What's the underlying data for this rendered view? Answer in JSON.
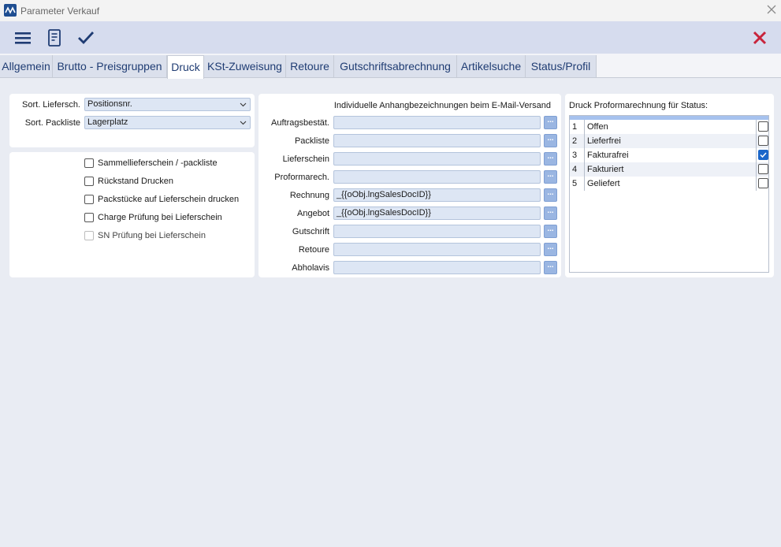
{
  "window": {
    "title": "Parameter Verkauf"
  },
  "tabs": [
    {
      "label": "Allgemein"
    },
    {
      "label": "Brutto - Preisgruppen"
    },
    {
      "label": "Druck"
    },
    {
      "label": "KSt-Zuweisung"
    },
    {
      "label": "Retoure"
    },
    {
      "label": "Gutschriftsabrechnung"
    },
    {
      "label": "Artikelsuche"
    },
    {
      "label": "Status/Profil"
    }
  ],
  "sort": {
    "liefersch_label": "Sort. Liefersch.",
    "liefersch_value": "Positionsnr.",
    "packliste_label": "Sort. Packliste",
    "packliste_value": "Lagerplatz"
  },
  "checkboxes": [
    {
      "label": "Sammellieferschein / -packliste",
      "checked": false,
      "disabled": false
    },
    {
      "label": "Rückstand Drucken",
      "checked": false,
      "disabled": false
    },
    {
      "label": "Packstücke auf Lieferschein drucken",
      "checked": false,
      "disabled": false
    },
    {
      "label": "Charge Prüfung bei Lieferschein",
      "checked": false,
      "disabled": false
    },
    {
      "label": "SN Prüfung bei Lieferschein",
      "checked": false,
      "disabled": true
    }
  ],
  "email": {
    "heading": "Individuelle Anhangbezeichnungen beim E-Mail-Versand",
    "button_label": "...",
    "fields": [
      {
        "label": "Auftragsbestät.",
        "value": ""
      },
      {
        "label": "Packliste",
        "value": ""
      },
      {
        "label": "Lieferschein",
        "value": ""
      },
      {
        "label": "Proformarech.",
        "value": ""
      },
      {
        "label": "Rechnung",
        "value": "_{{oObj.lngSalesDocID}}"
      },
      {
        "label": "Angebot",
        "value": "_{{oObj.lngSalesDocID}}"
      },
      {
        "label": "Gutschrift",
        "value": ""
      },
      {
        "label": "Retoure",
        "value": ""
      },
      {
        "label": "Abholavis",
        "value": ""
      }
    ]
  },
  "status": {
    "heading": "Druck Proformarechnung für Status:",
    "rows": [
      {
        "num": "1",
        "name": "Offen",
        "checked": false
      },
      {
        "num": "2",
        "name": "Lieferfrei",
        "checked": false
      },
      {
        "num": "3",
        "name": "Fakturafrei",
        "checked": true
      },
      {
        "num": "4",
        "name": "Fakturiert",
        "checked": false
      },
      {
        "num": "5",
        "name": "Geliefert",
        "checked": false
      }
    ]
  },
  "colors": {
    "accent": "#1f4e91",
    "toolbar": "#d6dcee",
    "close_red": "#c8243c"
  },
  "icons": [
    "app-logo-icon",
    "menu-icon",
    "document-icon",
    "checkmark-icon",
    "close-icon",
    "chevron-down-icon"
  ]
}
